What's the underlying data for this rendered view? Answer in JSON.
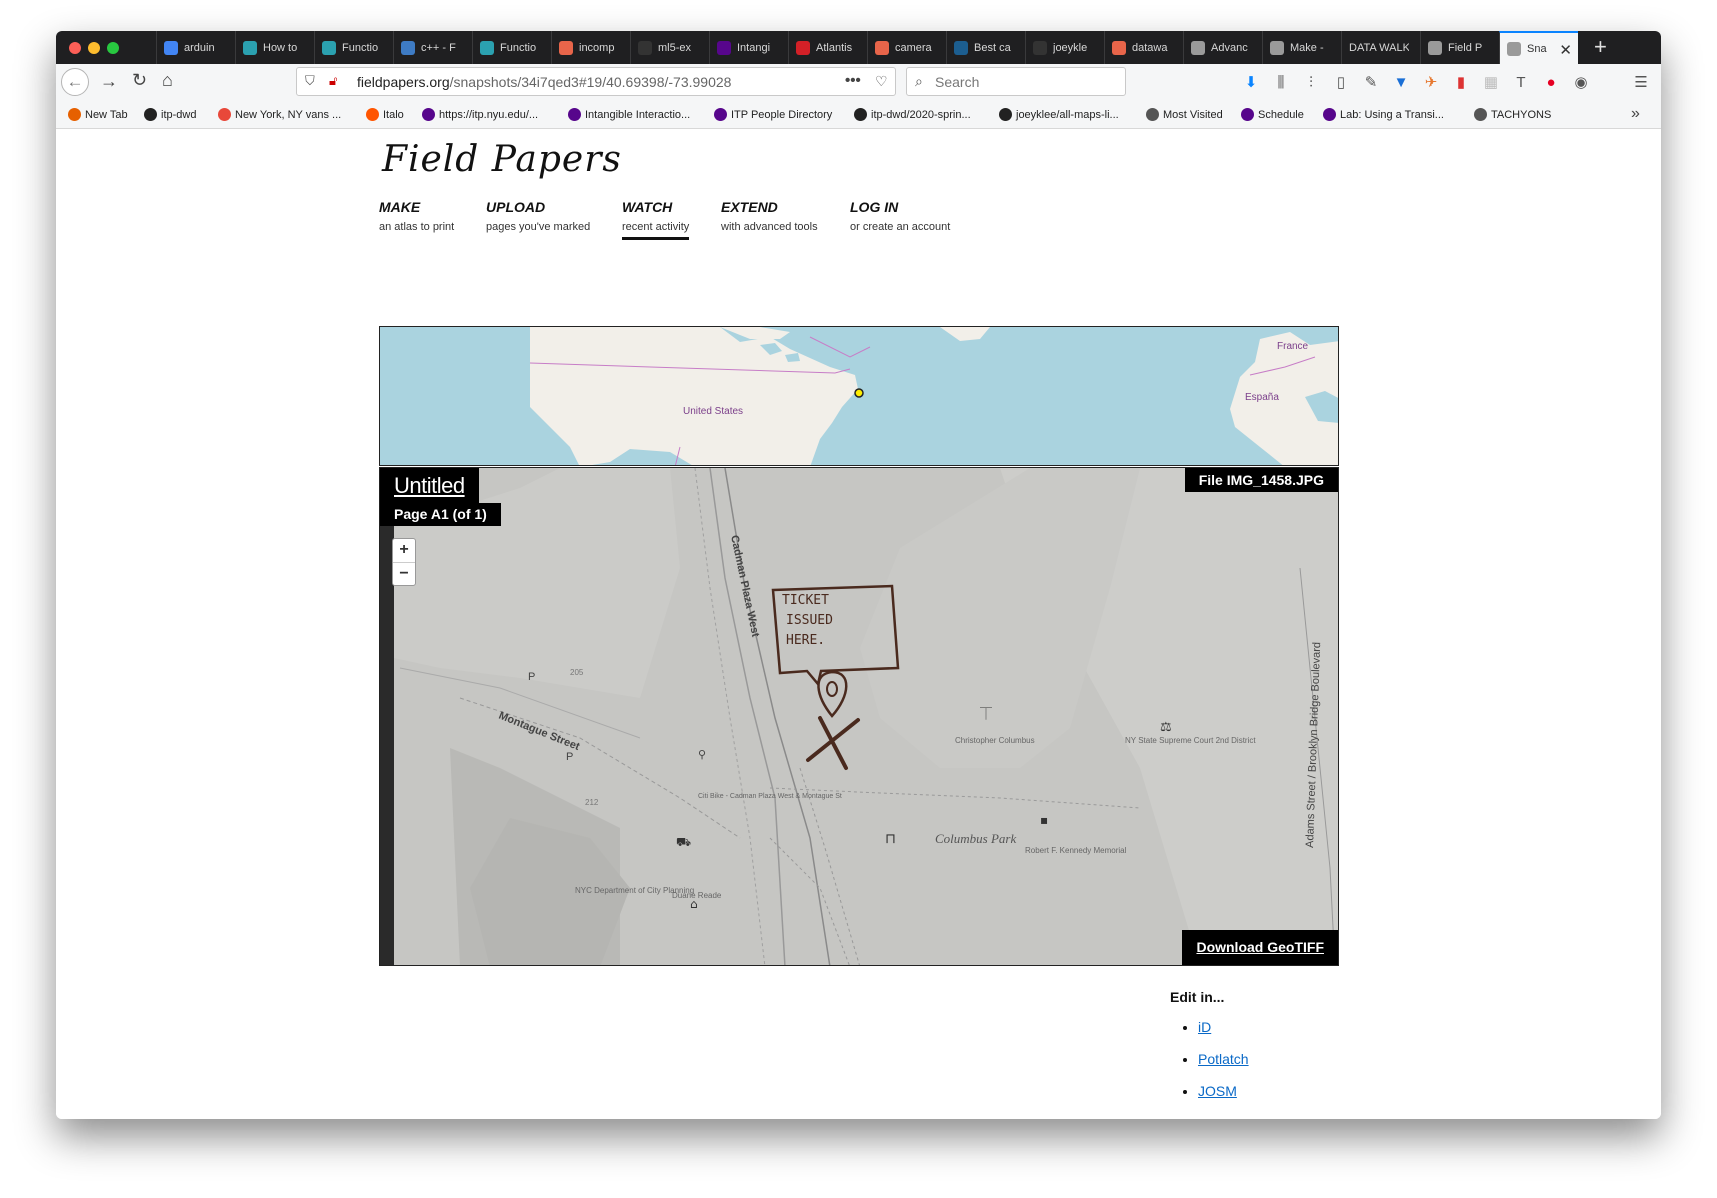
{
  "tabs": [
    {
      "label": "arduin",
      "color": "#4285f4"
    },
    {
      "label": "How to",
      "color": "#2ba1b0"
    },
    {
      "label": "Functio",
      "color": "#2ba1b0"
    },
    {
      "label": "c++ - F",
      "color": "#3e7bc4"
    },
    {
      "label": "Functio",
      "color": "#2ba1b0"
    },
    {
      "label": "incomp",
      "color": "#e8654a"
    },
    {
      "label": "ml5-ex",
      "color": "#333333"
    },
    {
      "label": "Intangi",
      "color": "#57068c"
    },
    {
      "label": "Atlantis",
      "color": "#d32027"
    },
    {
      "label": "camera",
      "color": "#e8654a"
    },
    {
      "label": "Best ca",
      "color": "#1c5e90"
    },
    {
      "label": "joeykle",
      "color": "#333333"
    },
    {
      "label": "datawa",
      "color": "#e8654a"
    },
    {
      "label": "Advanc",
      "color": "#9a9a9a"
    },
    {
      "label": "Make -",
      "color": "#9a9a9a"
    },
    {
      "label": "DATA WALK",
      "color": ""
    },
    {
      "label": "Field P",
      "color": "#9a9a9a"
    },
    {
      "label": "Sna",
      "color": "#9a9a9a",
      "active": true
    }
  ],
  "url": {
    "domain": "fieldpapers.org",
    "path": "/snapshots/34i7qed3#19/40.69398/-73.99028"
  },
  "search_placeholder": "Search",
  "bookmarks": [
    {
      "label": "New Tab",
      "color": "#e66000"
    },
    {
      "label": "itp-dwd",
      "color": "#222222"
    },
    {
      "label": "New York, NY vans ...",
      "color": "#e8483a"
    },
    {
      "label": "Italo",
      "color": "#ff5500"
    },
    {
      "label": "https://itp.nyu.edu/...",
      "color": "#57068c"
    },
    {
      "label": "Intangible Interactio...",
      "color": "#57068c"
    },
    {
      "label": "ITP People Directory",
      "color": "#57068c"
    },
    {
      "label": "itp-dwd/2020-sprin...",
      "color": "#222222"
    },
    {
      "label": "joeyklee/all-maps-li...",
      "color": "#222222"
    },
    {
      "label": "Most Visited",
      "color": "#555555"
    },
    {
      "label": "Schedule",
      "color": "#57068c"
    },
    {
      "label": "Lab: Using a Transi...",
      "color": "#57068c"
    },
    {
      "label": "TACHYONS",
      "color": "#555555"
    }
  ],
  "site": {
    "logo": "Field Papers"
  },
  "nav": [
    {
      "title": "MAKE",
      "sub": "an atlas to print"
    },
    {
      "title": "UPLOAD",
      "sub": "pages you've marked"
    },
    {
      "title": "WATCH",
      "sub": "recent activity",
      "active": true
    },
    {
      "title": "EXTEND",
      "sub": "with advanced tools"
    },
    {
      "title": "LOG IN",
      "sub": "or create an account"
    }
  ],
  "overview_map": {
    "labels": {
      "us": "United States",
      "france": "France",
      "espana": "España"
    }
  },
  "snapshot": {
    "title": "Untitled",
    "page": "Page A1 (of 1)",
    "file": "File IMG_1458.JPG",
    "download": "Download GeoTIFF",
    "zoom_in": "+",
    "zoom_out": "−",
    "map_labels": {
      "cadman": "Cadman Plaza West",
      "montague": "Montague Street",
      "adams": "Adams Street / Brooklyn Bridge Boulevard",
      "columbus_park": "Columbus Park",
      "christopher": "Christopher Columbus",
      "nystate": "NY State Supreme Court 2nd District",
      "robert": "Robert F. Kennedy Memorial",
      "nycdep": "NYC Department of City Planning",
      "citibike": "Citi Bike - Cadman Plaza West & Montague St",
      "duane": "Duane Reade",
      "num205": "205",
      "num212": "212",
      "ticket": "TICKET ISSUED HERE."
    }
  },
  "edit": {
    "heading": "Edit in...",
    "links": [
      "iD",
      "Potlatch",
      "JOSM"
    ]
  }
}
